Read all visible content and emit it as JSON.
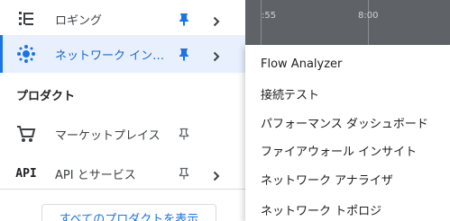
{
  "nav": {
    "items": [
      {
        "label": "ロギング",
        "icon": "logging-icon"
      },
      {
        "label": "ネットワーク イン…",
        "icon": "network-intelligence-icon"
      },
      {
        "label": "マーケットプレイス",
        "icon": "marketplace-cart-icon"
      },
      {
        "label": "API とサービス",
        "icon": "api-icon",
        "icon_text": "API"
      }
    ],
    "section_heading": "プロダクト",
    "all_products_button": "すべてのプロダクトを表示"
  },
  "chart_bg": {
    "ticks": [
      ":55",
      "8:00"
    ]
  },
  "submenu": {
    "items": [
      "Flow Analyzer",
      "接続テスト",
      "パフォーマンス ダッシュボード",
      "ファイアウォール インサイト",
      "ネットワーク アナライザ",
      "ネットワーク トポロジ"
    ]
  },
  "colors": {
    "accent": "#1a73e8",
    "active_bg": "#e8f0fe"
  }
}
